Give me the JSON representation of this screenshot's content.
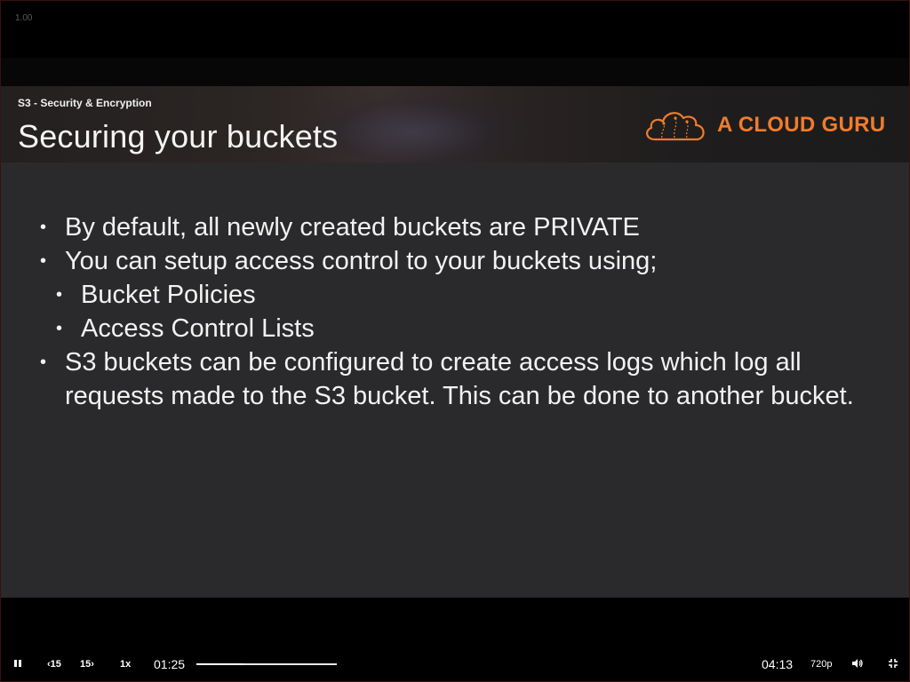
{
  "player": {
    "speed_badge": "1.00"
  },
  "slide": {
    "subtitle": "S3 - Security & Encryption",
    "title": "Securing your buckets",
    "brand": "A CLOUD GURU",
    "bullets": [
      {
        "level": 1,
        "text": "By default, all newly created buckets are PRIVATE"
      },
      {
        "level": 1,
        "text": "You can setup access control to your buckets using;"
      },
      {
        "level": 2,
        "text": "Bucket Policies"
      },
      {
        "level": 2,
        "text": "Access Control Lists"
      },
      {
        "level": 1,
        "text": "S3 buckets can be configured to create access logs which log all requests made to the S3 bucket. This can be done to another bucket."
      }
    ]
  },
  "controls": {
    "pause_icon": "pause-icon",
    "rewind_label": "15",
    "forward_label": "15",
    "speed_label": "1x",
    "current_time": "01:25",
    "duration": "04:13",
    "quality_label": "720p",
    "volume_icon": "volume-icon",
    "fullscreen_icon": "exit-fullscreen-icon",
    "progress_fraction": 0.336
  },
  "colors": {
    "brand": "#f07c2c",
    "slide_bg": "#2a2a2c"
  }
}
